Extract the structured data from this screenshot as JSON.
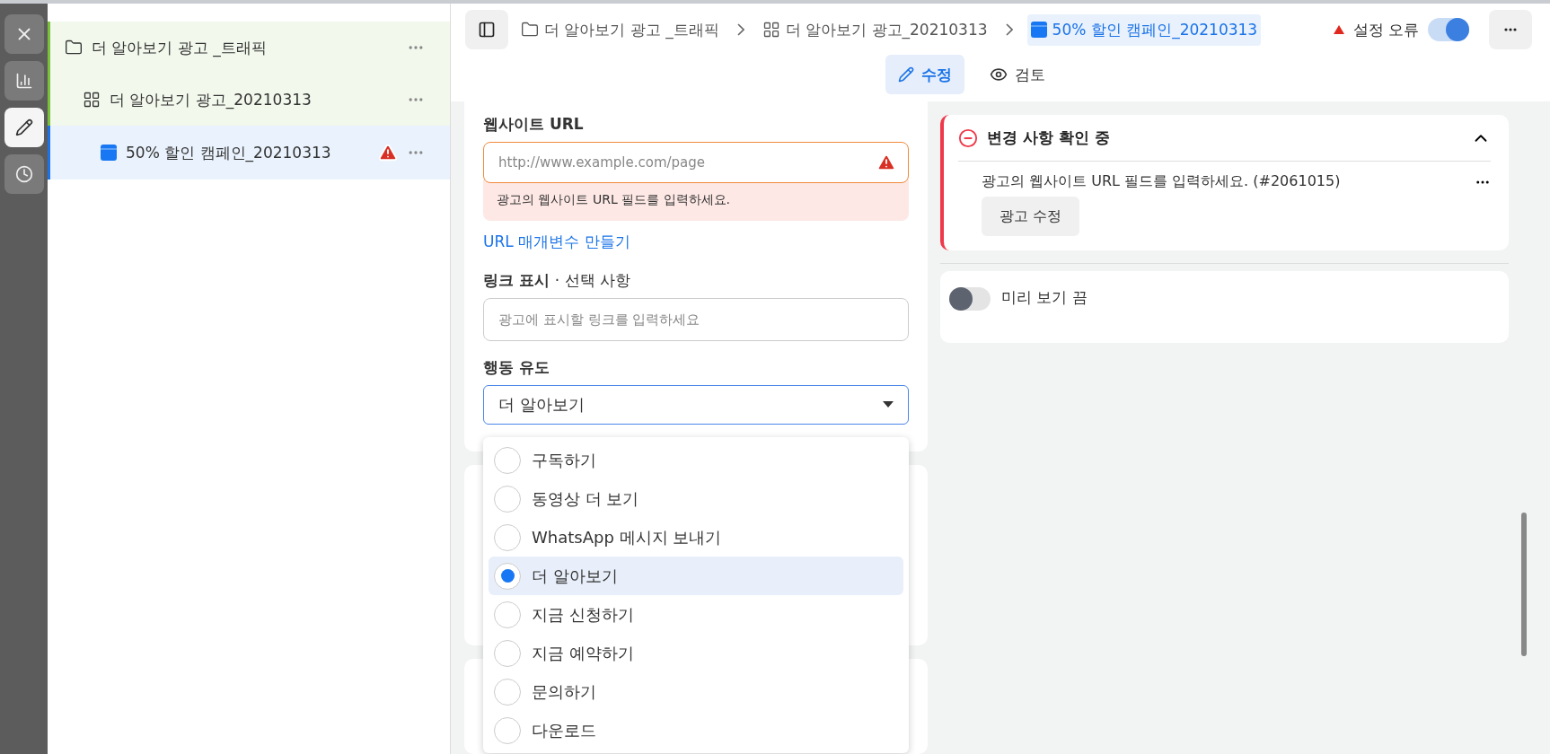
{
  "tree": [
    {
      "kind": "campaign",
      "label": "더 알아보기 광고 _트래픽",
      "selected": false,
      "error": false
    },
    {
      "kind": "adset",
      "label": "더 알아보기 광고_20210313",
      "selected": false,
      "error": false
    },
    {
      "kind": "ad",
      "label": "50% 할인 캠페인_20210313",
      "selected": true,
      "error": true
    }
  ],
  "breadcrumbs": [
    {
      "kind": "campaign",
      "label": "더 알아보기 광고 _트래픽",
      "selected": false
    },
    {
      "kind": "adset",
      "label": "더 알아보기 광고_20210313",
      "selected": false
    },
    {
      "kind": "ad",
      "label": "50% 할인 캠페인_20210313",
      "selected": true
    }
  ],
  "status": {
    "label": "설정 오류",
    "on": true
  },
  "modes": [
    {
      "kind": "edit",
      "label": "수정",
      "selected": true
    },
    {
      "kind": "review",
      "label": "검토",
      "selected": false
    }
  ],
  "form": {
    "website_label": "웹사이트 URL",
    "website_placeholder": "http://www.example.com/page",
    "website_error": "광고의 웹사이트 URL 필드를 입력하세요.",
    "url_params_link": "URL 매개변수 만들기",
    "display_label": "링크 표시",
    "display_optional": "· 선택 사항",
    "display_placeholder": "광고에 표시할 링크를 입력하세요",
    "cta_label": "행동 유도",
    "cta_value": "더 알아보기",
    "cta_options": [
      {
        "label": "구독하기",
        "selected": false
      },
      {
        "label": "동영상 더 보기",
        "selected": false
      },
      {
        "label": "WhatsApp 메시지 보내기",
        "selected": false
      },
      {
        "label": "더 알아보기",
        "selected": true
      },
      {
        "label": "지금 신청하기",
        "selected": false
      },
      {
        "label": "지금 예약하기",
        "selected": false
      },
      {
        "label": "문의하기",
        "selected": false
      },
      {
        "label": "다운로드",
        "selected": false
      }
    ]
  },
  "review": {
    "title": "변경 사항 확인 중",
    "expanded": true,
    "message": "광고의 웹사이트 URL 필드를 입력하세요. (#2061015)",
    "button": "광고 수정"
  },
  "preview": {
    "label": "미리 보기 끔",
    "on": false
  }
}
